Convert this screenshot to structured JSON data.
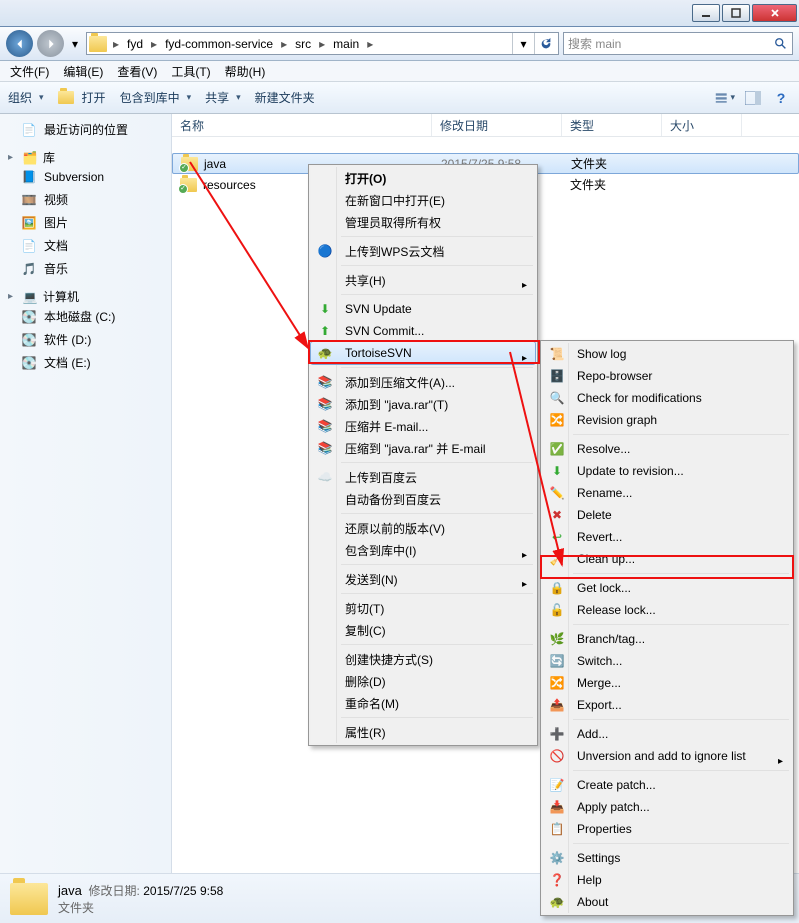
{
  "titlebar": {
    "min": "_",
    "max": "□",
    "close": "×"
  },
  "breadcrumb": {
    "parts": [
      "fyd",
      "fyd-common-service",
      "src",
      "main"
    ]
  },
  "search": {
    "placeholder": "搜索 main"
  },
  "menubar": {
    "file": "文件(F)",
    "edit": "编辑(E)",
    "view": "查看(V)",
    "tools": "工具(T)",
    "help": "帮助(H)"
  },
  "toolbar": {
    "org": "组织",
    "open": "打开",
    "include": "包含到库中",
    "share": "共享",
    "newfolder": "新建文件夹"
  },
  "sidebar": {
    "recent": "最近访问的位置",
    "libs": "库",
    "svn": "Subversion",
    "video": "视频",
    "pics": "图片",
    "docs": "文档",
    "music": "音乐",
    "computer": "计算机",
    "c": "本地磁盘 (C:)",
    "d": "软件 (D:)",
    "e": "文档 (E:)"
  },
  "columns": {
    "name": "名称",
    "modified": "修改日期",
    "type": "类型",
    "size": "大小"
  },
  "files": {
    "r0": {
      "name": "java",
      "date": "2015/7/25 9:58",
      "type": "文件夹"
    },
    "r1": {
      "name": "resources",
      "date": "",
      "type": "文件夹"
    }
  },
  "details": {
    "name": "java",
    "datelabel": "修改日期:",
    "date": "2015/7/25 9:58",
    "type": "文件夹"
  },
  "ctx1": {
    "open": "打开(O)",
    "opennew": "在新窗口中打开(E)",
    "admin": "管理员取得所有权",
    "wps": "上传到WPS云文档",
    "share": "共享(H)",
    "svnup": "SVN Update",
    "svncommit": "SVN Commit...",
    "tortoise": "TortoiseSVN",
    "addarc": "添加到压缩文件(A)...",
    "addrar": "添加到 \"java.rar\"(T)",
    "email": "压缩并 E-mail...",
    "raremail": "压缩到 \"java.rar\" 并 E-mail",
    "baidu": "上传到百度云",
    "baidubak": "自动备份到百度云",
    "restore": "还原以前的版本(V)",
    "inclib": "包含到库中(I)",
    "sendto": "发送到(N)",
    "cut": "剪切(T)",
    "copy": "复制(C)",
    "shortcut": "创建快捷方式(S)",
    "delete": "删除(D)",
    "rename": "重命名(M)",
    "props": "属性(R)"
  },
  "ctx2": {
    "showlog": "Show log",
    "repo": "Repo-browser",
    "checkmod": "Check for modifications",
    "revgraph": "Revision graph",
    "resolve": "Resolve...",
    "update": "Update to revision...",
    "rename": "Rename...",
    "delete": "Delete",
    "revert": "Revert...",
    "cleanup": "Clean up...",
    "getlock": "Get lock...",
    "release": "Release lock...",
    "branch": "Branch/tag...",
    "switch": "Switch...",
    "merge": "Merge...",
    "export": "Export...",
    "add": "Add...",
    "unversion": "Unversion and add to ignore list",
    "createpatch": "Create patch...",
    "applypatch": "Apply patch...",
    "properties": "Properties",
    "settings": "Settings",
    "help": "Help",
    "about": "About"
  }
}
